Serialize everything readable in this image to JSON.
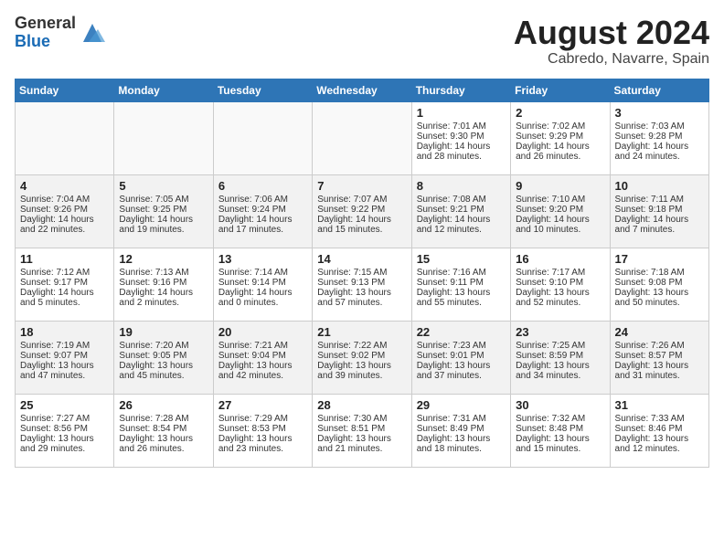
{
  "logo": {
    "general": "General",
    "blue": "Blue"
  },
  "title": {
    "month_year": "August 2024",
    "location": "Cabredo, Navarre, Spain"
  },
  "days_of_week": [
    "Sunday",
    "Monday",
    "Tuesday",
    "Wednesday",
    "Thursday",
    "Friday",
    "Saturday"
  ],
  "weeks": [
    [
      {
        "day": "",
        "info": ""
      },
      {
        "day": "",
        "info": ""
      },
      {
        "day": "",
        "info": ""
      },
      {
        "day": "",
        "info": ""
      },
      {
        "day": "1",
        "info": "Sunrise: 7:01 AM\nSunset: 9:30 PM\nDaylight: 14 hours\nand 28 minutes."
      },
      {
        "day": "2",
        "info": "Sunrise: 7:02 AM\nSunset: 9:29 PM\nDaylight: 14 hours\nand 26 minutes."
      },
      {
        "day": "3",
        "info": "Sunrise: 7:03 AM\nSunset: 9:28 PM\nDaylight: 14 hours\nand 24 minutes."
      }
    ],
    [
      {
        "day": "4",
        "info": "Sunrise: 7:04 AM\nSunset: 9:26 PM\nDaylight: 14 hours\nand 22 minutes."
      },
      {
        "day": "5",
        "info": "Sunrise: 7:05 AM\nSunset: 9:25 PM\nDaylight: 14 hours\nand 19 minutes."
      },
      {
        "day": "6",
        "info": "Sunrise: 7:06 AM\nSunset: 9:24 PM\nDaylight: 14 hours\nand 17 minutes."
      },
      {
        "day": "7",
        "info": "Sunrise: 7:07 AM\nSunset: 9:22 PM\nDaylight: 14 hours\nand 15 minutes."
      },
      {
        "day": "8",
        "info": "Sunrise: 7:08 AM\nSunset: 9:21 PM\nDaylight: 14 hours\nand 12 minutes."
      },
      {
        "day": "9",
        "info": "Sunrise: 7:10 AM\nSunset: 9:20 PM\nDaylight: 14 hours\nand 10 minutes."
      },
      {
        "day": "10",
        "info": "Sunrise: 7:11 AM\nSunset: 9:18 PM\nDaylight: 14 hours\nand 7 minutes."
      }
    ],
    [
      {
        "day": "11",
        "info": "Sunrise: 7:12 AM\nSunset: 9:17 PM\nDaylight: 14 hours\nand 5 minutes."
      },
      {
        "day": "12",
        "info": "Sunrise: 7:13 AM\nSunset: 9:16 PM\nDaylight: 14 hours\nand 2 minutes."
      },
      {
        "day": "13",
        "info": "Sunrise: 7:14 AM\nSunset: 9:14 PM\nDaylight: 14 hours\nand 0 minutes."
      },
      {
        "day": "14",
        "info": "Sunrise: 7:15 AM\nSunset: 9:13 PM\nDaylight: 13 hours\nand 57 minutes."
      },
      {
        "day": "15",
        "info": "Sunrise: 7:16 AM\nSunset: 9:11 PM\nDaylight: 13 hours\nand 55 minutes."
      },
      {
        "day": "16",
        "info": "Sunrise: 7:17 AM\nSunset: 9:10 PM\nDaylight: 13 hours\nand 52 minutes."
      },
      {
        "day": "17",
        "info": "Sunrise: 7:18 AM\nSunset: 9:08 PM\nDaylight: 13 hours\nand 50 minutes."
      }
    ],
    [
      {
        "day": "18",
        "info": "Sunrise: 7:19 AM\nSunset: 9:07 PM\nDaylight: 13 hours\nand 47 minutes."
      },
      {
        "day": "19",
        "info": "Sunrise: 7:20 AM\nSunset: 9:05 PM\nDaylight: 13 hours\nand 45 minutes."
      },
      {
        "day": "20",
        "info": "Sunrise: 7:21 AM\nSunset: 9:04 PM\nDaylight: 13 hours\nand 42 minutes."
      },
      {
        "day": "21",
        "info": "Sunrise: 7:22 AM\nSunset: 9:02 PM\nDaylight: 13 hours\nand 39 minutes."
      },
      {
        "day": "22",
        "info": "Sunrise: 7:23 AM\nSunset: 9:01 PM\nDaylight: 13 hours\nand 37 minutes."
      },
      {
        "day": "23",
        "info": "Sunrise: 7:25 AM\nSunset: 8:59 PM\nDaylight: 13 hours\nand 34 minutes."
      },
      {
        "day": "24",
        "info": "Sunrise: 7:26 AM\nSunset: 8:57 PM\nDaylight: 13 hours\nand 31 minutes."
      }
    ],
    [
      {
        "day": "25",
        "info": "Sunrise: 7:27 AM\nSunset: 8:56 PM\nDaylight: 13 hours\nand 29 minutes."
      },
      {
        "day": "26",
        "info": "Sunrise: 7:28 AM\nSunset: 8:54 PM\nDaylight: 13 hours\nand 26 minutes."
      },
      {
        "day": "27",
        "info": "Sunrise: 7:29 AM\nSunset: 8:53 PM\nDaylight: 13 hours\nand 23 minutes."
      },
      {
        "day": "28",
        "info": "Sunrise: 7:30 AM\nSunset: 8:51 PM\nDaylight: 13 hours\nand 21 minutes."
      },
      {
        "day": "29",
        "info": "Sunrise: 7:31 AM\nSunset: 8:49 PM\nDaylight: 13 hours\nand 18 minutes."
      },
      {
        "day": "30",
        "info": "Sunrise: 7:32 AM\nSunset: 8:48 PM\nDaylight: 13 hours\nand 15 minutes."
      },
      {
        "day": "31",
        "info": "Sunrise: 7:33 AM\nSunset: 8:46 PM\nDaylight: 13 hours\nand 12 minutes."
      }
    ]
  ]
}
